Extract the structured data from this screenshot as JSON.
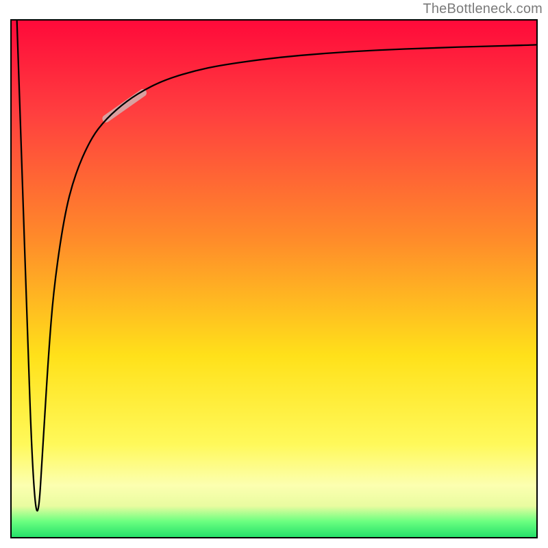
{
  "watermark": "TheBottleneck.com",
  "chart_data": {
    "type": "line",
    "title": "",
    "xlabel": "",
    "ylabel": "",
    "xlim": [
      0,
      100
    ],
    "ylim": [
      0,
      100
    ],
    "grid": false,
    "notes": "Vertical gradient background from red (top) through orange/yellow to green (bottom). Curve: steep drop from (≈1,100) to a narrow minimum at ≈(5,2), then rises rapidly approaching an asymptote near y≈95. A short pale highlight segment sits on the rising limb around x 18–25.",
    "series": [
      {
        "name": "curve",
        "x": [
          1,
          2,
          3,
          4,
          5,
          6,
          7,
          8,
          10,
          12,
          15,
          18,
          22,
          26,
          30,
          35,
          40,
          50,
          60,
          70,
          80,
          90,
          100
        ],
        "y": [
          100,
          70,
          40,
          12,
          2,
          18,
          35,
          48,
          62,
          70,
          77,
          81,
          84.5,
          87,
          88.8,
          90.3,
          91.4,
          92.8,
          93.7,
          94.3,
          94.7,
          95.0,
          95.3
        ]
      }
    ],
    "highlight_segment": {
      "x_start": 18,
      "x_end": 25,
      "approx_y_start": 81,
      "approx_y_end": 86
    },
    "background_gradient": {
      "direction": "top-to-bottom",
      "stops": [
        {
          "pos": 0.0,
          "color": "#ff0a3a"
        },
        {
          "pos": 0.18,
          "color": "#ff3f3f"
        },
        {
          "pos": 0.42,
          "color": "#ff8a2a"
        },
        {
          "pos": 0.65,
          "color": "#ffe11a"
        },
        {
          "pos": 0.82,
          "color": "#fff95a"
        },
        {
          "pos": 0.9,
          "color": "#fcffb0"
        },
        {
          "pos": 0.94,
          "color": "#e9fca0"
        },
        {
          "pos": 0.97,
          "color": "#6aff80"
        },
        {
          "pos": 1.0,
          "color": "#25e06a"
        }
      ]
    }
  }
}
